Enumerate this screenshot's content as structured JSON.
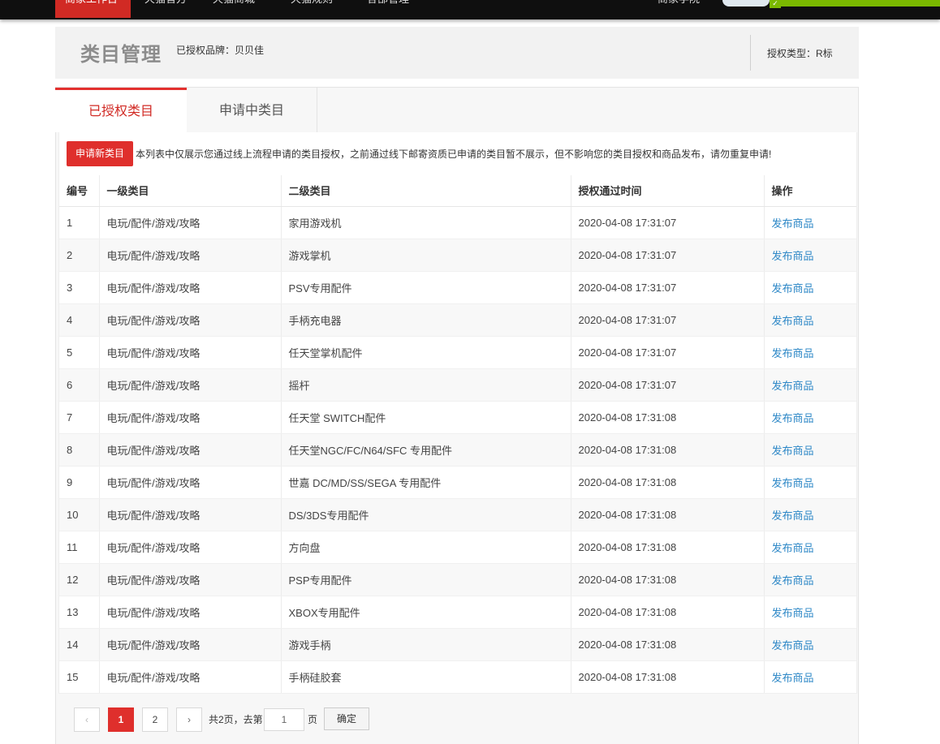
{
  "topnav": {
    "items": [
      "商家工作台",
      "天猫官方",
      "天猫商城",
      "天猫规则",
      "各部管理"
    ],
    "right_text": "商家学院"
  },
  "header": {
    "title": "类目管理",
    "brand": "已授权品牌：贝贝佳",
    "auth_type": "授权类型：R标"
  },
  "tabs": [
    {
      "label": "已授权类目",
      "active": true
    },
    {
      "label": "申请中类目",
      "active": false
    }
  ],
  "notice": {
    "apply_button": "申请新类目",
    "text": "本列表中仅展示您通过线上流程申请的类目授权，之前通过线下邮寄资质已申请的类目暂不展示，但不影响您的类目授权和商品发布，请勿重复申请!"
  },
  "table": {
    "headers": [
      "编号",
      "一级类目",
      "二级类目",
      "授权通过时间",
      "操作"
    ],
    "rows": [
      {
        "no": "1",
        "l1": "电玩/配件/游戏/攻略",
        "l2": "家用游戏机",
        "time": "2020-04-08 17:31:07",
        "op": "发布商品"
      },
      {
        "no": "2",
        "l1": "电玩/配件/游戏/攻略",
        "l2": "游戏掌机",
        "time": "2020-04-08 17:31:07",
        "op": "发布商品"
      },
      {
        "no": "3",
        "l1": "电玩/配件/游戏/攻略",
        "l2": "PSV专用配件",
        "time": "2020-04-08 17:31:07",
        "op": "发布商品"
      },
      {
        "no": "4",
        "l1": "电玩/配件/游戏/攻略",
        "l2": "手柄充电器",
        "time": "2020-04-08 17:31:07",
        "op": "发布商品"
      },
      {
        "no": "5",
        "l1": "电玩/配件/游戏/攻略",
        "l2": "任天堂掌机配件",
        "time": "2020-04-08 17:31:07",
        "op": "发布商品"
      },
      {
        "no": "6",
        "l1": "电玩/配件/游戏/攻略",
        "l2": "摇杆",
        "time": "2020-04-08 17:31:07",
        "op": "发布商品"
      },
      {
        "no": "7",
        "l1": "电玩/配件/游戏/攻略",
        "l2": "任天堂 SWITCH配件",
        "time": "2020-04-08 17:31:08",
        "op": "发布商品"
      },
      {
        "no": "8",
        "l1": "电玩/配件/游戏/攻略",
        "l2": "任天堂NGC/FC/N64/SFC 专用配件",
        "time": "2020-04-08 17:31:08",
        "op": "发布商品"
      },
      {
        "no": "9",
        "l1": "电玩/配件/游戏/攻略",
        "l2": "世嘉 DC/MD/SS/SEGA 专用配件",
        "time": "2020-04-08 17:31:08",
        "op": "发布商品"
      },
      {
        "no": "10",
        "l1": "电玩/配件/游戏/攻略",
        "l2": "DS/3DS专用配件",
        "time": "2020-04-08 17:31:08",
        "op": "发布商品"
      },
      {
        "no": "11",
        "l1": "电玩/配件/游戏/攻略",
        "l2": "方向盘",
        "time": "2020-04-08 17:31:08",
        "op": "发布商品"
      },
      {
        "no": "12",
        "l1": "电玩/配件/游戏/攻略",
        "l2": "PSP专用配件",
        "time": "2020-04-08 17:31:08",
        "op": "发布商品"
      },
      {
        "no": "13",
        "l1": "电玩/配件/游戏/攻略",
        "l2": "XBOX专用配件",
        "time": "2020-04-08 17:31:08",
        "op": "发布商品"
      },
      {
        "no": "14",
        "l1": "电玩/配件/游戏/攻略",
        "l2": "游戏手柄",
        "time": "2020-04-08 17:31:08",
        "op": "发布商品"
      },
      {
        "no": "15",
        "l1": "电玩/配件/游戏/攻略",
        "l2": "手柄硅胶套",
        "time": "2020-04-08 17:31:08",
        "op": "发布商品"
      }
    ]
  },
  "pagination": {
    "prev": "‹",
    "pages": [
      "1",
      "2"
    ],
    "current": "1",
    "next": "›",
    "total_text": "共2页，去第",
    "input_value": "1",
    "unit": "页",
    "confirm": "确定"
  },
  "colors": {
    "accent": "#df2f2c",
    "link": "#2e88c7"
  }
}
